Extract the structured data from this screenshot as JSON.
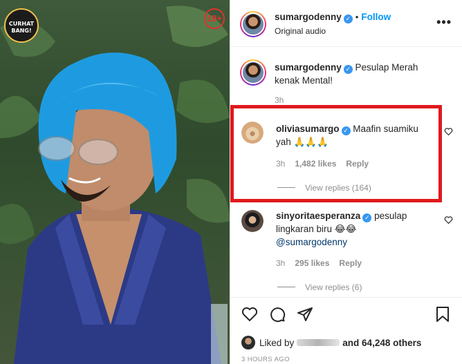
{
  "media": {
    "logo_text": "CURHAT BANG!",
    "age_badge": "18+"
  },
  "header": {
    "username": "sumargodenny",
    "follow_label": "Follow",
    "dot": "•",
    "subtitle": "Original audio",
    "more_label": "•••"
  },
  "caption": {
    "username": "sumargodenny",
    "text": "Pesulap Merah kenak Mental!",
    "time": "3h"
  },
  "comments": [
    {
      "username": "oliviasumargo",
      "text": "Maafin suamiku yah 🙏🙏🙏",
      "time": "3h",
      "likes": "1,482 likes",
      "reply_label": "Reply",
      "view_replies": "View replies (164)"
    },
    {
      "username": "sinyoritaesperanza",
      "text": "pesulap lingkaran biru 😂😂",
      "mention": "@sumargodenny",
      "time": "3h",
      "likes": "295 likes",
      "reply_label": "Reply",
      "view_replies": "View replies (6)"
    }
  ],
  "footer": {
    "liked_by_label": "Liked by",
    "others": "and 64,248 others",
    "timestamp": "3 HOURS AGO"
  },
  "colors": {
    "accent": "#0095f6",
    "verified": "#3897f0",
    "highlight": "#e0191e",
    "age_badge": "#e0322c"
  },
  "icons": [
    "heart-icon",
    "comment-icon",
    "share-icon",
    "bookmark-icon",
    "more-icon",
    "verified-icon"
  ]
}
